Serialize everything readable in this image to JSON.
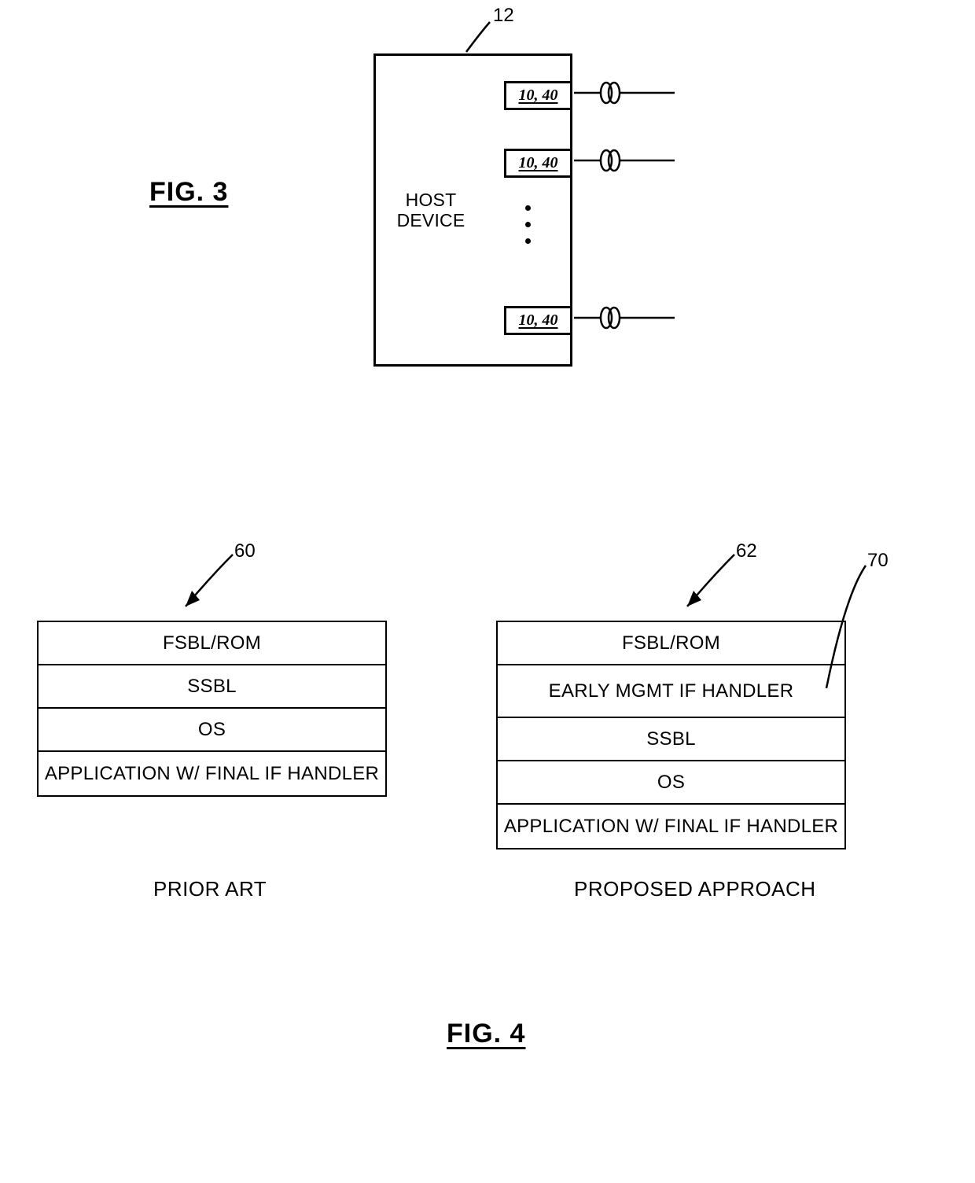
{
  "fig3": {
    "title": "FIG. 3",
    "ref_12": "12",
    "host_label_line1": "HOST",
    "host_label_line2": "DEVICE",
    "module_label": "10, 40"
  },
  "fig4": {
    "title": "FIG. 4",
    "ref_60": "60",
    "ref_62": "62",
    "ref_70": "70",
    "prior_caption": "PRIOR ART",
    "proposed_caption": "PROPOSED APPROACH",
    "prior_stack": {
      "r0": "FSBL/ROM",
      "r1": "SSBL",
      "r2": "OS",
      "r3": "APPLICATION W/ FINAL IF HANDLER"
    },
    "proposed_stack": {
      "r0": "FSBL/ROM",
      "r1": "EARLY MGMT IF HANDLER",
      "r2": "SSBL",
      "r3": "OS",
      "r4": "APPLICATION W/ FINAL IF HANDLER"
    }
  },
  "chart_data": [
    {
      "type": "diagram",
      "figure": "FIG. 3",
      "description": "Host device with multiple pluggable modules (ref 10, 40) each attached to a fiber. Host device ref 12."
    },
    {
      "type": "diagram",
      "figure": "FIG. 4",
      "left": {
        "label": "PRIOR ART",
        "ref": 60,
        "stack": [
          "FSBL/ROM",
          "SSBL",
          "OS",
          "APPLICATION W/ FINAL IF HANDLER"
        ]
      },
      "right": {
        "label": "PROPOSED APPROACH",
        "ref": 62,
        "early_handler_ref": 70,
        "stack": [
          "FSBL/ROM",
          "EARLY MGMT IF HANDLER",
          "SSBL",
          "OS",
          "APPLICATION W/ FINAL IF HANDLER"
        ]
      }
    }
  ]
}
